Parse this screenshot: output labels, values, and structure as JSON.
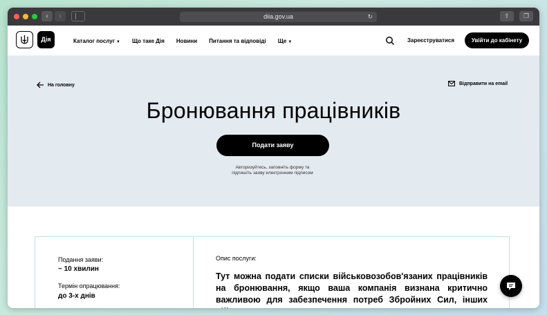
{
  "browser": {
    "url": "diia.gov.ua",
    "back_label": "‹",
    "forward_label": "›"
  },
  "header": {
    "logo_text": "Дія",
    "nav": [
      {
        "label": "Каталог послуг",
        "dropdown": true
      },
      {
        "label": "Що таке Дія",
        "dropdown": false
      },
      {
        "label": "Новини",
        "dropdown": false
      },
      {
        "label": "Питання та відповіді",
        "dropdown": false
      },
      {
        "label": "Ще",
        "dropdown": true
      }
    ],
    "register_label": "Зареєструватися",
    "login_label": "Увійти до кабінету"
  },
  "hero": {
    "back_label": "На головну",
    "email_label": "Відправити на email",
    "title": "Бронювання працівників",
    "submit_label": "Подати заяву",
    "note_line1": "Авторизуйтесь, заповніть форму та",
    "note_line2": "підпишіть заяву електронним підписом"
  },
  "service": {
    "submit_time_label": "Подання заяви:",
    "submit_time_value": "~ 10 хвилин",
    "processing_label": "Термін опрацювання:",
    "processing_value": "до 3-х днів",
    "description_label": "Опис послуги:",
    "description_text": "Тут можна подати списки військовозобов'язаних працівників на бронювання, якщо ваша компанія визнана критично важливою для забезпечення потреб Збройних Сил, інших військових"
  },
  "colors": {
    "hero_bg": "#e3eaf0",
    "accent_border": "#bfe3e6",
    "primary": "#000000"
  }
}
